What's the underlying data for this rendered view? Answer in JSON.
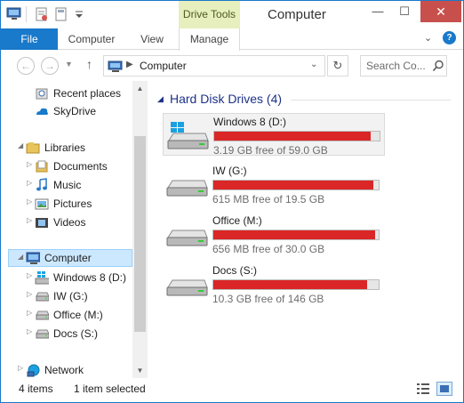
{
  "window": {
    "title": "Computer",
    "contextual_tab_group": "Drive Tools",
    "controls": {
      "minimize": "—",
      "maximize": "☐",
      "close": "✕"
    }
  },
  "ribbon": {
    "tabs": [
      {
        "label": "File",
        "active": false
      },
      {
        "label": "Computer",
        "active": false
      },
      {
        "label": "View",
        "active": false
      },
      {
        "label": "Manage",
        "active": true
      }
    ],
    "help": "?"
  },
  "address_bar": {
    "path": "Computer",
    "search_placeholder": "Search Co..."
  },
  "sidebar": {
    "items": [
      {
        "label": "Recent places",
        "icon": "recent-places-icon"
      },
      {
        "label": "SkyDrive",
        "icon": "skydrive-icon"
      },
      {
        "label": "Libraries",
        "icon": "libraries-icon",
        "expanded": true
      },
      {
        "label": "Documents",
        "icon": "documents-icon"
      },
      {
        "label": "Music",
        "icon": "music-icon"
      },
      {
        "label": "Pictures",
        "icon": "pictures-icon"
      },
      {
        "label": "Videos",
        "icon": "videos-icon"
      },
      {
        "label": "Computer",
        "icon": "computer-icon",
        "expanded": true,
        "selected": true
      },
      {
        "label": "Windows 8 (D:)",
        "icon": "windows-drive-icon"
      },
      {
        "label": "IW (G:)",
        "icon": "drive-icon"
      },
      {
        "label": "Office (M:)",
        "icon": "drive-icon"
      },
      {
        "label": "Docs (S:)",
        "icon": "drive-icon"
      },
      {
        "label": "Network",
        "icon": "network-icon"
      }
    ]
  },
  "main": {
    "group_title": "Hard Disk Drives (4)",
    "drives": [
      {
        "name": "Windows 8 (D:)",
        "free_text": "3.19 GB free of 59.0 GB",
        "used_fraction": 0.946,
        "selected": true,
        "icon": "windows-drive-icon"
      },
      {
        "name": "IW (G:)",
        "free_text": "615 MB free of 19.5 GB",
        "used_fraction": 0.969,
        "selected": false,
        "icon": "hard-drive-icon"
      },
      {
        "name": "Office (M:)",
        "free_text": "656 MB free of 30.0 GB",
        "used_fraction": 0.978,
        "selected": false,
        "icon": "hard-drive-icon"
      },
      {
        "name": "Docs (S:)",
        "free_text": "10.3 GB free of 146 GB",
        "used_fraction": 0.929,
        "selected": false,
        "icon": "hard-drive-icon"
      }
    ]
  },
  "status_bar": {
    "item_count": "4 items",
    "selection": "1 item selected"
  },
  "colors": {
    "accent": "#1979ca",
    "usage_bar": "#da2626",
    "group_title": "#1e3287",
    "selection_bg": "#cce8ff"
  }
}
